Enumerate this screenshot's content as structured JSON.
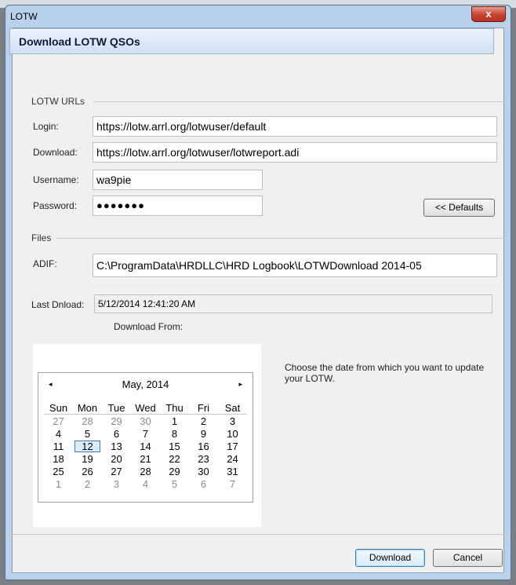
{
  "window": {
    "title": "LOTW",
    "close_glyph": "x"
  },
  "header": {
    "title": "Download LOTW QSOs"
  },
  "urls_group": {
    "label": "LOTW URLs",
    "login_label": "Login:",
    "login_value": "https://lotw.arrl.org/lotwuser/default",
    "download_label": "Download:",
    "download_value": "https://lotw.arrl.org/lotwuser/lotwreport.adi",
    "username_label": "Username:",
    "username_value": "wa9pie",
    "password_label": "Password:",
    "password_value": "●●●●●●●",
    "defaults_button": "<< Defaults"
  },
  "files_group": {
    "label": "Files",
    "adif_label": "ADIF:",
    "adif_value": "C:\\ProgramData\\HRDLLC\\HRD Logbook\\LOTWDownload 2014-05"
  },
  "last_download": {
    "label": "Last Dnload:",
    "value": "5/12/2014 12:41:20 AM"
  },
  "download_from_label": "Download From:",
  "calendar": {
    "prev": "◂",
    "next": "▸",
    "month": "May, 2014",
    "weekdays": [
      "Sun",
      "Mon",
      "Tue",
      "Wed",
      "Thu",
      "Fri",
      "Sat"
    ],
    "weeks": [
      [
        "27",
        "28",
        "29",
        "30",
        "1",
        "2",
        "3"
      ],
      [
        "4",
        "5",
        "6",
        "7",
        "8",
        "9",
        "10"
      ],
      [
        "11",
        "12",
        "13",
        "14",
        "15",
        "16",
        "17"
      ],
      [
        "18",
        "19",
        "20",
        "21",
        "22",
        "23",
        "24"
      ],
      [
        "25",
        "26",
        "27",
        "28",
        "29",
        "30",
        "31"
      ],
      [
        "1",
        "2",
        "3",
        "4",
        "5",
        "6",
        "7"
      ]
    ],
    "selected": "12"
  },
  "hint": "Choose the date from which you want to update your LOTW.",
  "buttons": {
    "download": "Download",
    "cancel": "Cancel"
  }
}
